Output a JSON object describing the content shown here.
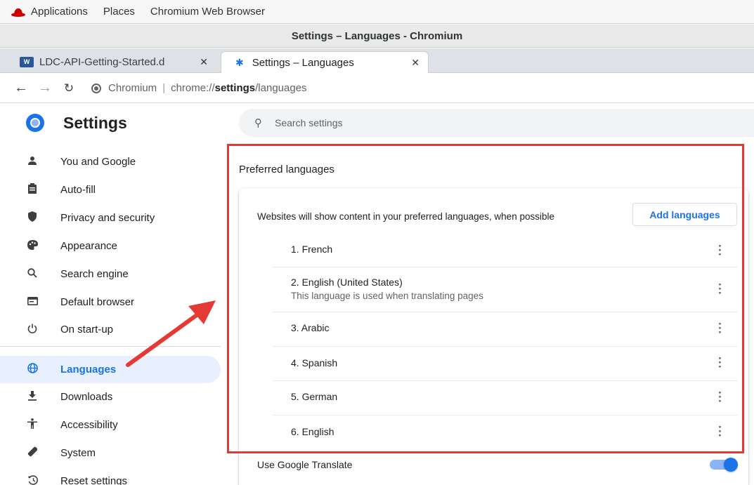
{
  "topbar": {
    "items": [
      "Applications",
      "Places",
      "Chromium Web Browser"
    ]
  },
  "window": {
    "title": "Settings – Languages - Chromium"
  },
  "tabs": [
    {
      "label": "LDC-API-Getting-Started.d",
      "icon": "word-doc-icon",
      "active": false
    },
    {
      "label": "Settings – Languages",
      "icon": "gear-icon",
      "active": true
    }
  ],
  "toolbar": {
    "origin": "Chromium",
    "url_scheme": "chrome://",
    "url_host": "settings",
    "url_path": "/languages"
  },
  "settings": {
    "title": "Settings",
    "search_placeholder": "Search settings"
  },
  "sidebar": {
    "items": [
      {
        "label": "You and Google",
        "icon": "person-icon"
      },
      {
        "label": "Auto-fill",
        "icon": "clipboard-icon"
      },
      {
        "label": "Privacy and security",
        "icon": "shield-icon"
      },
      {
        "label": "Appearance",
        "icon": "palette-icon"
      },
      {
        "label": "Search engine",
        "icon": "search-icon"
      },
      {
        "label": "Default browser",
        "icon": "browser-window-icon"
      },
      {
        "label": "On start-up",
        "icon": "power-icon"
      },
      {
        "label": "Languages",
        "icon": "globe-icon",
        "active": true
      },
      {
        "label": "Downloads",
        "icon": "download-icon"
      },
      {
        "label": "Accessibility",
        "icon": "accessibility-icon"
      },
      {
        "label": "System",
        "icon": "wrench-icon"
      },
      {
        "label": "Reset settings",
        "icon": "history-icon"
      }
    ]
  },
  "languages": {
    "heading": "Preferred languages",
    "description": "Websites will show content in your preferred languages, when possible",
    "add_button": "Add languages",
    "list": [
      {
        "name": "1. French",
        "note": ""
      },
      {
        "name": "2. English (United States)",
        "note": "This language is used when translating pages"
      },
      {
        "name": "3. Arabic",
        "note": ""
      },
      {
        "name": "4. Spanish",
        "note": ""
      },
      {
        "name": "5. German",
        "note": ""
      },
      {
        "name": "6. English",
        "note": ""
      }
    ],
    "translate_label": "Use Google Translate",
    "translate_enabled": true
  },
  "colors": {
    "accent": "#1a73e8",
    "annotation": "#e53935",
    "active_bg": "#e8f0fe"
  }
}
